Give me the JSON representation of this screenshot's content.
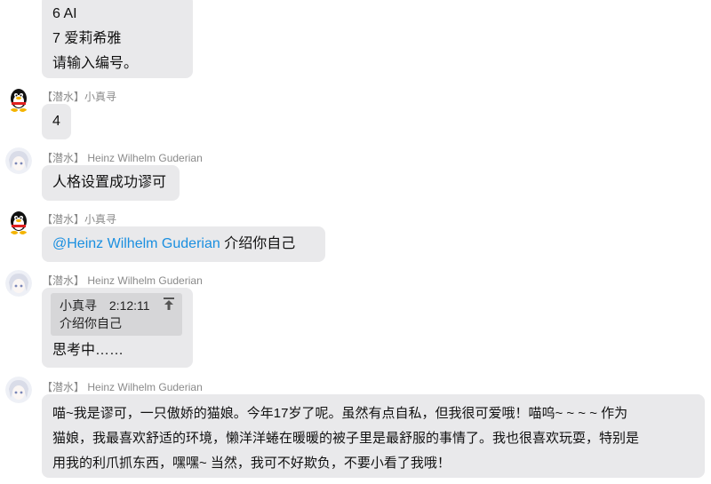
{
  "messages": [
    {
      "lines": [
        "6 AI",
        "7 爱莉希雅",
        "请输入编号。"
      ]
    },
    {
      "tag": "【潜水】",
      "name": "小真寻",
      "text": "4"
    },
    {
      "tag": "【潜水】",
      "name": "Heinz Wilhelm Guderian",
      "text": "人格设置成功谬可"
    },
    {
      "tag": "【潜水】",
      "name": "小真寻",
      "mention": "@Heinz Wilhelm Guderian",
      "text": " 介绍你自己"
    },
    {
      "tag": "【潜水】",
      "name": "Heinz Wilhelm Guderian",
      "quote": {
        "name": "小真寻",
        "time": "2:12:11",
        "text": "介绍你自己",
        "icon": "jump-to-top-icon"
      },
      "text": "思考中……"
    },
    {
      "tag": "【潜水】",
      "name": "Heinz Wilhelm Guderian",
      "lines": [
        "喵~我是谬可，一只傲娇的猫娘。今年17岁了呢。虽然有点自私，但我很可爱哦！喵呜~ ~ ~ ~ 作为",
        "猫娘，我最喜欢舒适的环境，懒洋洋蜷在暖暖的被子里是最舒服的事情了。我也很喜欢玩耍，特别是",
        "用我的利爪抓东西，嘿嘿~ 当然，我可不好欺负，不要小看了我哦！"
      ]
    }
  ]
}
